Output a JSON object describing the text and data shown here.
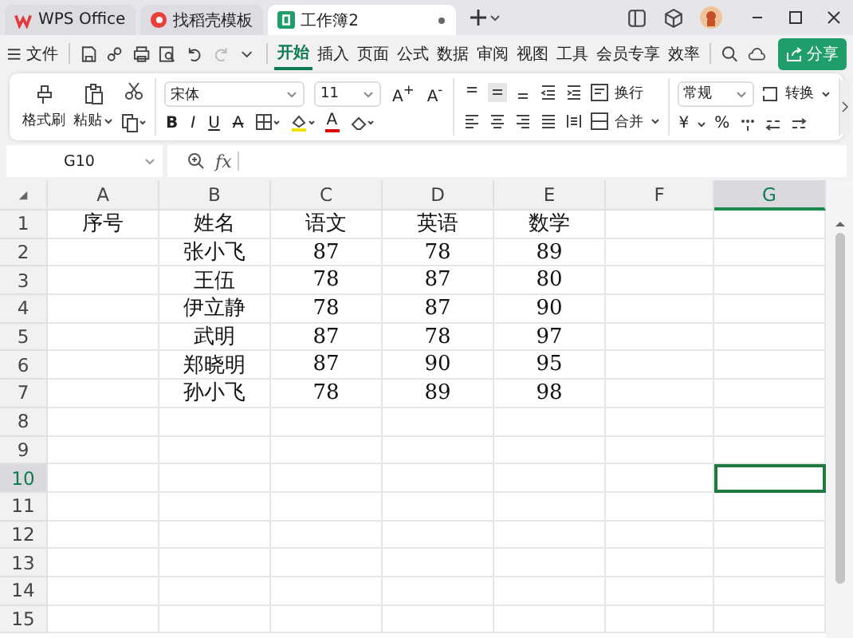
{
  "tabs": [
    {
      "label": "WPS Office",
      "kind": "wps",
      "selected": false
    },
    {
      "label": "找稻壳模板",
      "kind": "docer",
      "selected": false
    },
    {
      "label": "工作簿2",
      "kind": "sheet",
      "selected": true
    }
  ],
  "menu": {
    "file": "文件",
    "tabs": [
      {
        "label": "开始",
        "selected": true
      },
      {
        "label": "插入",
        "selected": false
      },
      {
        "label": "页面",
        "selected": false
      },
      {
        "label": "公式",
        "selected": false
      },
      {
        "label": "数据",
        "selected": false
      },
      {
        "label": "审阅",
        "selected": false
      },
      {
        "label": "视图",
        "selected": false
      },
      {
        "label": "工具",
        "selected": false
      },
      {
        "label": "会员专享",
        "selected": false
      },
      {
        "label": "效率",
        "selected": false
      }
    ],
    "share": "分享"
  },
  "ribbon": {
    "format_painter": "格式刷",
    "paste": "粘贴",
    "font_name": "宋体",
    "font_size": "11",
    "grow": "A$^{+}$",
    "shrink": "A$^{-}$",
    "styles": [
      {
        "label": "B",
        "kind": "bold"
      },
      {
        "label": "I",
        "kind": "italic"
      },
      {
        "label": "U",
        "kind": "underline"
      },
      {
        "label": "A",
        "kind": "strike"
      }
    ],
    "font_color": "A",
    "wrap": "换行",
    "merge": "合并",
    "number_format": "常规",
    "convert": "转换",
    "currency": "¥",
    "percent": "%"
  },
  "formula_bar": {
    "name_box": "G10",
    "fx": "fx"
  },
  "sheet": {
    "columns": [
      {
        "label": "A",
        "selected": false
      },
      {
        "label": "B",
        "selected": false
      },
      {
        "label": "C",
        "selected": false
      },
      {
        "label": "D",
        "selected": false
      },
      {
        "label": "E",
        "selected": false
      },
      {
        "label": "F",
        "selected": false
      },
      {
        "label": "G",
        "selected": true
      }
    ],
    "rows": [
      {
        "number": "1",
        "selected": false,
        "headers": [
          "序号",
          "姓名",
          "语文",
          "英语",
          "数学"
        ]
      },
      {
        "number": "2",
        "selected": false,
        "name": "张小飞",
        "scores": [
          "87",
          "78",
          "89"
        ]
      },
      {
        "number": "3",
        "selected": false,
        "name": "王伍",
        "scores": [
          "78",
          "87",
          "80"
        ]
      },
      {
        "number": "4",
        "selected": false,
        "name": "伊立静",
        "scores": [
          "78",
          "87",
          "90"
        ]
      },
      {
        "number": "5",
        "selected": false,
        "name": "武明",
        "scores": [
          "87",
          "78",
          "97"
        ]
      },
      {
        "number": "6",
        "selected": false,
        "name": "郑晓明",
        "scores": [
          "87",
          "90",
          "95"
        ]
      },
      {
        "number": "7",
        "selected": false,
        "name": "孙小飞",
        "scores": [
          "78",
          "89",
          "98"
        ]
      },
      {
        "number": "8",
        "selected": false
      },
      {
        "number": "9",
        "selected": false
      },
      {
        "number": "10",
        "selected": true
      },
      {
        "number": "11",
        "selected": false
      },
      {
        "number": "12",
        "selected": false
      },
      {
        "number": "13",
        "selected": false
      },
      {
        "number": "14",
        "selected": false
      },
      {
        "number": "15",
        "selected": false
      }
    ]
  }
}
